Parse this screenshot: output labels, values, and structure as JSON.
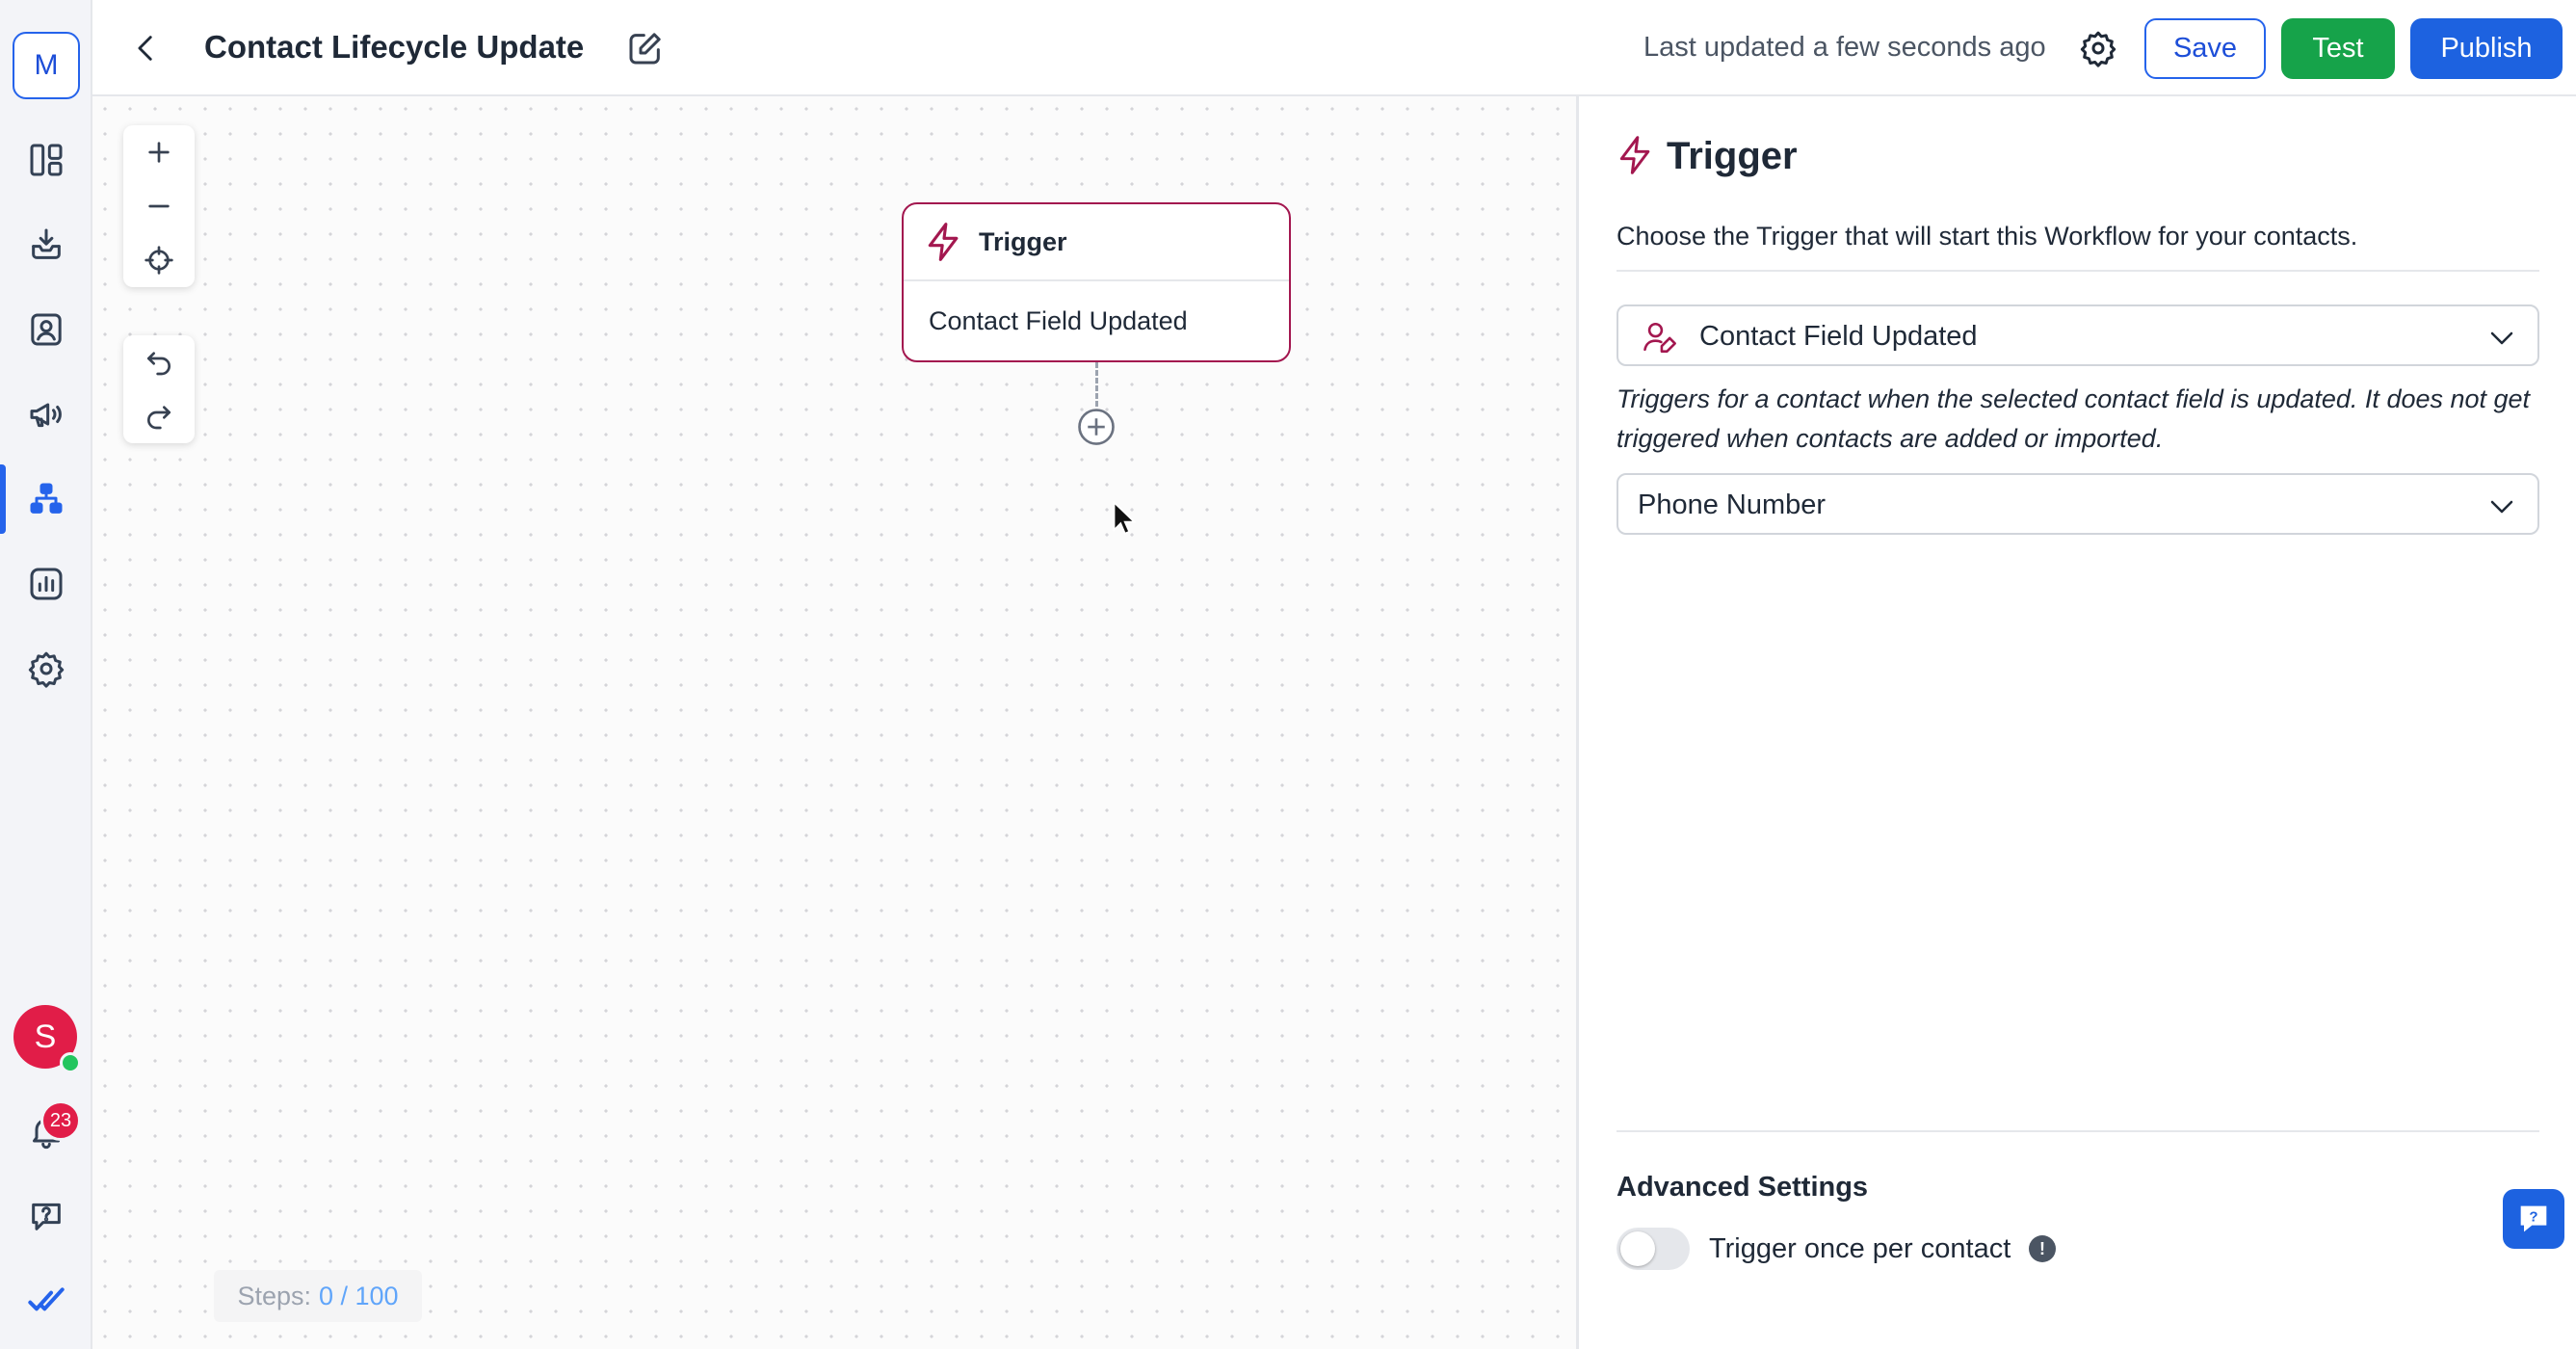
{
  "sidebar": {
    "workspace_initial": "M",
    "items": [
      {
        "name": "dashboard",
        "icon": "dashboard-icon"
      },
      {
        "name": "inbox",
        "icon": "inbox-icon"
      },
      {
        "name": "contacts",
        "icon": "contacts-icon"
      },
      {
        "name": "campaigns",
        "icon": "megaphone-icon"
      },
      {
        "name": "workflows",
        "icon": "workflow-icon",
        "active": true
      },
      {
        "name": "reports",
        "icon": "bar-chart-icon"
      },
      {
        "name": "settings",
        "icon": "gear-icon"
      }
    ],
    "user_initial": "S",
    "notification_count": "23",
    "accent_color": "#2563eb"
  },
  "header": {
    "title": "Contact Lifecycle Update",
    "last_updated": "Last updated a few seconds ago",
    "save_label": "Save",
    "test_label": "Test",
    "publish_label": "Publish"
  },
  "canvas": {
    "node": {
      "title": "Trigger",
      "subtitle": "Contact Field Updated",
      "border_color": "#a3174f"
    },
    "steps": {
      "label": "Steps:",
      "value": "0 / 100"
    }
  },
  "panel": {
    "title": "Trigger",
    "description": "Choose the Trigger that will start this Workflow for your contacts.",
    "trigger_select": {
      "value": "Contact Field Updated"
    },
    "trigger_help": "Triggers for a contact when the selected contact field is updated. It does not get triggered when contacts are added or imported.",
    "field_select": {
      "value": "Phone Number"
    },
    "advanced": {
      "title": "Advanced Settings",
      "toggle_label": "Trigger once per contact",
      "toggle_on": false,
      "info_glyph": "!"
    }
  }
}
